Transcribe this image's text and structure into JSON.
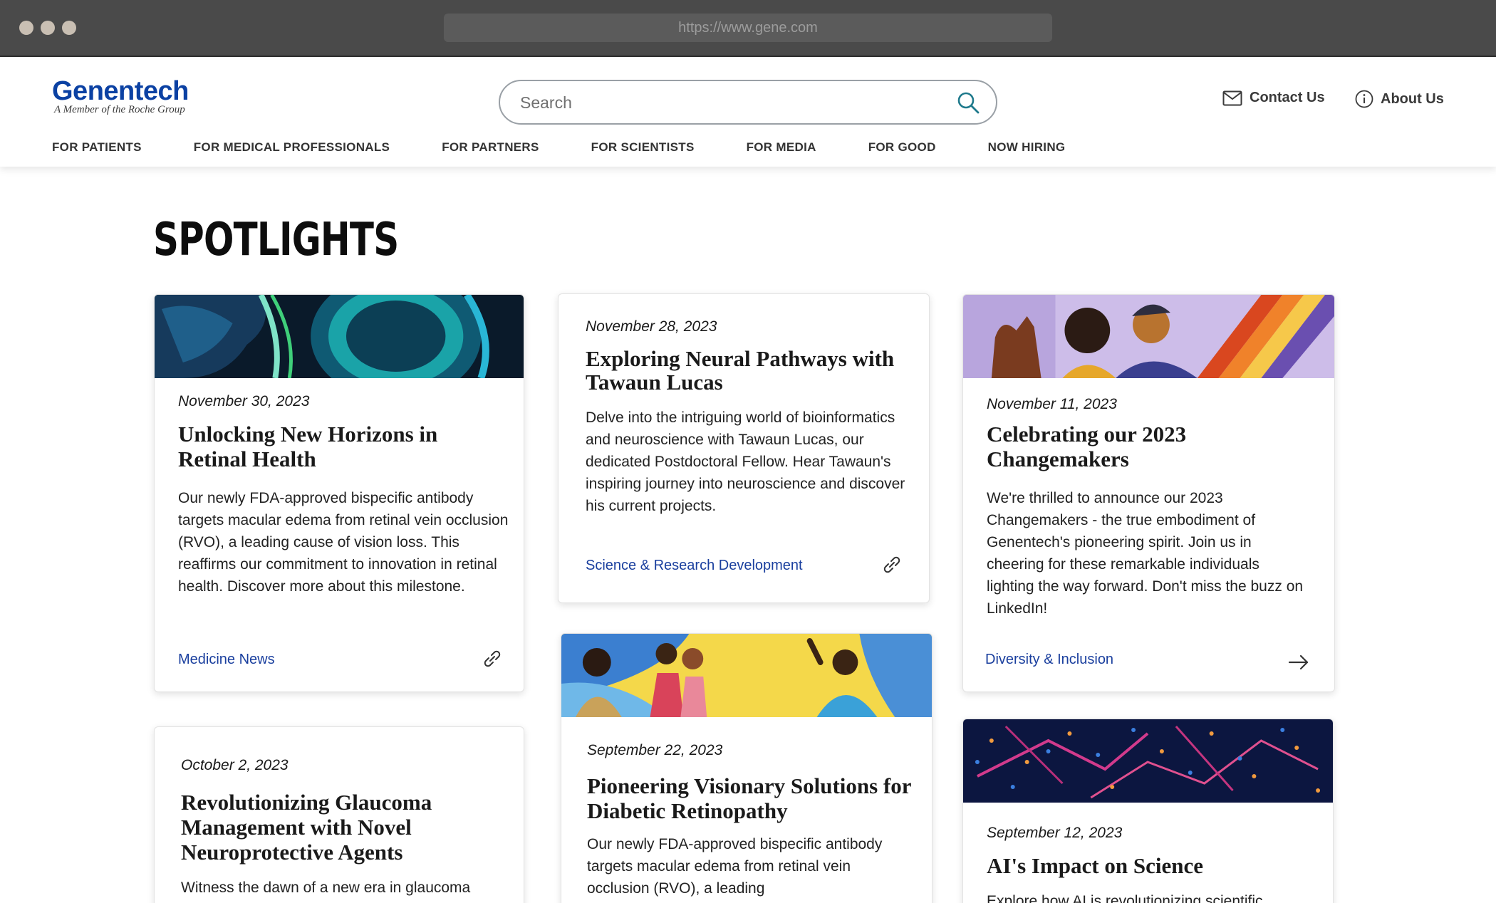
{
  "browser": {
    "url": "https://www.gene.com"
  },
  "header": {
    "logo_main": "Genentech",
    "logo_sub": "A Member of the Roche Group",
    "search_placeholder": "Search",
    "contact_label": "Contact Us",
    "about_label": "About Us",
    "nav": [
      "FOR PATIENTS",
      "FOR MEDICAL PROFESSIONALS",
      "FOR PARTNERS",
      "FOR SCIENTISTS",
      "FOR MEDIA",
      "FOR GOOD",
      "NOW HIRING"
    ]
  },
  "page": {
    "title": "SPOTLIGHTS"
  },
  "cards": [
    {
      "date": "November 30, 2023",
      "title": "Unlocking New Horizons in Retinal Health",
      "desc": "Our newly FDA-approved bispecific antibody targets macular edema from retinal vein occlusion (RVO), a leading cause of vision loss. This reaffirms our commitment to innovation in retinal health. Discover more about this milestone.",
      "category": "Medicine News",
      "action_icon": "link-icon"
    },
    {
      "date": "November 28, 2023",
      "title": "Exploring Neural Pathways with Tawaun Lucas",
      "desc": "Delve into the intriguing world of bioinformatics and neuroscience with Tawaun Lucas, our dedicated Postdoctoral Fellow. Hear Tawaun's inspiring journey into neuroscience and discover his current projects.",
      "category": "Science & Research Development",
      "action_icon": "link-icon"
    },
    {
      "date": "November 11, 2023",
      "title": "Celebrating our 2023 Changemakers",
      "desc": "We're thrilled to announce our 2023 Changemakers - the true embodiment of Genentech's pioneering spirit. Join us in cheering for these remarkable individuals lighting the way forward. Don't miss the buzz on LinkedIn!",
      "category": "Diversity & Inclusion",
      "action_icon": "arrow-right-icon"
    },
    {
      "date": "October  2, 2023",
      "title": "Revolutionizing Glaucoma Management with Novel Neuroprotective Agents",
      "desc": "Witness the dawn of a new era in glaucoma"
    },
    {
      "date": "September 22, 2023",
      "title": "Pioneering Visionary Solutions for Diabetic Retinopathy",
      "desc": "Our newly FDA-approved bispecific antibody targets macular edema from retinal vein occlusion (RVO), a leading"
    },
    {
      "date": "September 12, 2023",
      "title": "AI's Impact on Science",
      "desc": "Explore how AI is revolutionizing scientific"
    }
  ],
  "colors": {
    "brand": "#0b41a3",
    "link": "#1a3f9e",
    "chrome": "#4a4a4a"
  }
}
